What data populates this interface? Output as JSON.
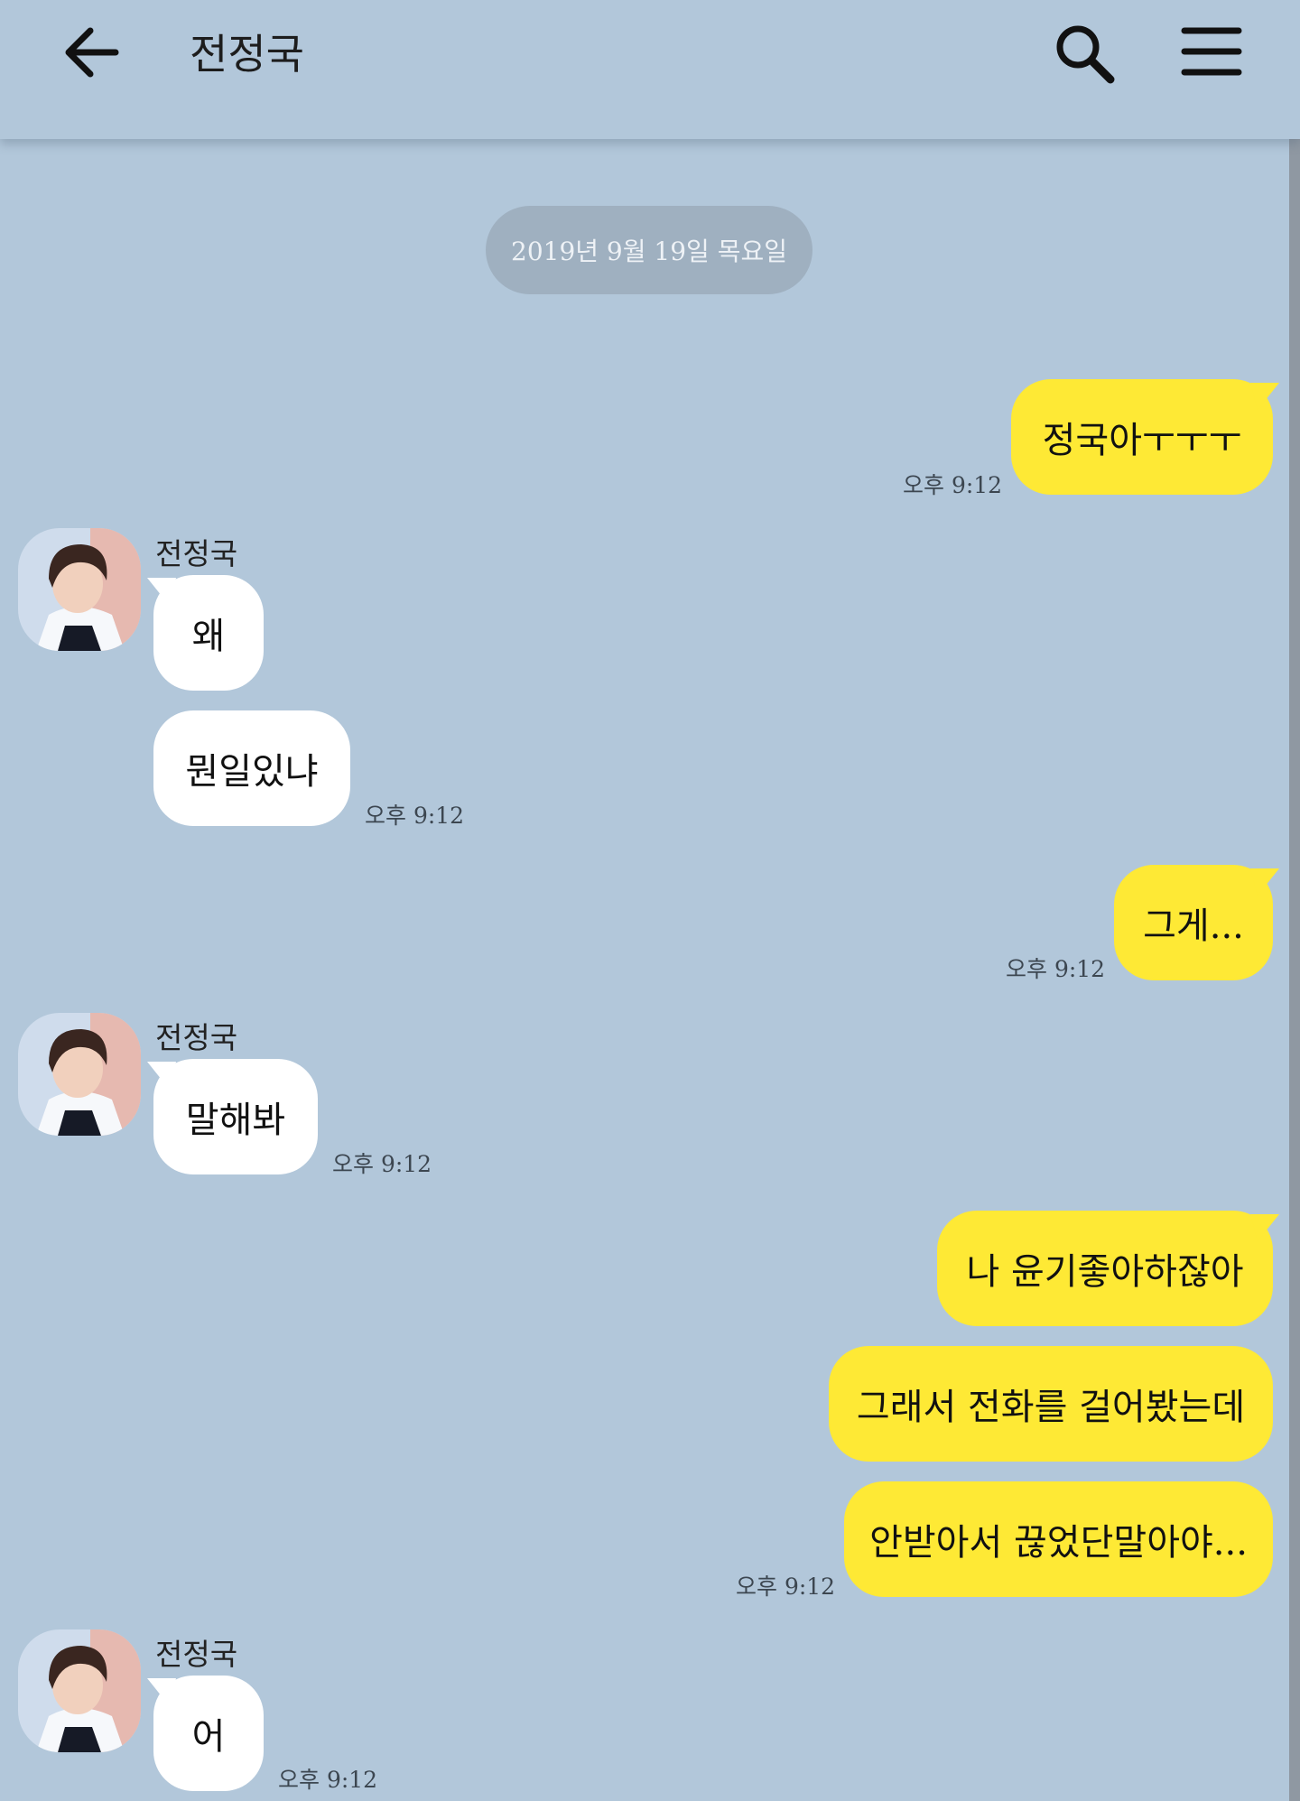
{
  "header": {
    "title": "전정국"
  },
  "date_divider": "2019년 9월 19일 목요일",
  "messages": [
    {
      "text": "정국아ㅜㅜㅜ",
      "time": "오후 9:12"
    },
    {
      "sender": "전정국",
      "text": "왜"
    },
    {
      "text": "뭔일있냐",
      "time": "오후 9:12"
    },
    {
      "text": "그게...",
      "time": "오후 9:12"
    },
    {
      "sender": "전정국",
      "text": "말해봐",
      "time": "오후 9:12"
    },
    {
      "text": "나 윤기좋아하잖아"
    },
    {
      "text": "그래서 전화를 걸어봤는데"
    },
    {
      "text": "안받아서 끊었단말아야...",
      "time": "오후 9:12"
    },
    {
      "sender": "전정국",
      "text": "어",
      "time": "오후 9:12"
    }
  ],
  "colors": {
    "background": "#b2c7da",
    "my_bubble": "#fee935",
    "their_bubble": "#ffffff"
  }
}
